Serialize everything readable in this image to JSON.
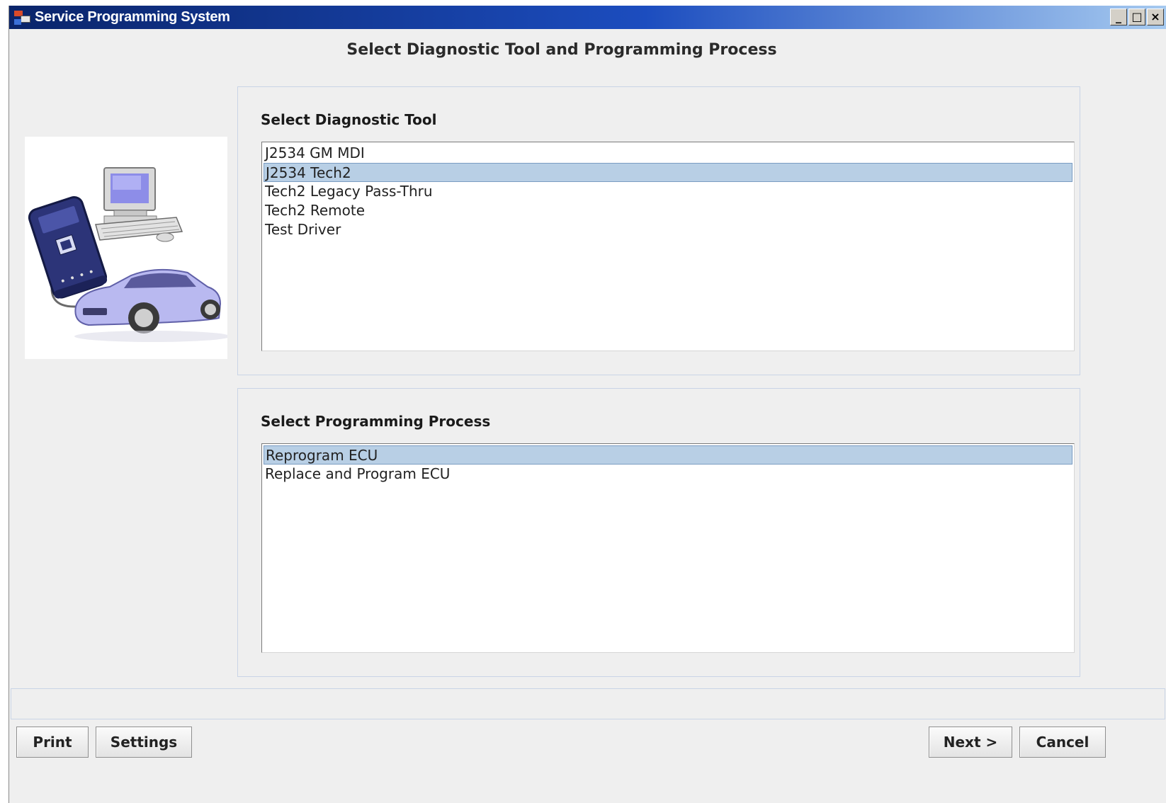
{
  "window": {
    "title": "Service Programming System",
    "controls": [
      "_",
      "□",
      "×"
    ]
  },
  "page": {
    "heading": "Select Diagnostic Tool and Programming Process"
  },
  "diagnostic_tool": {
    "label": "Select Diagnostic Tool",
    "items": [
      {
        "label": "J2534 GM MDI",
        "selected": false
      },
      {
        "label": "J2534 Tech2",
        "selected": true
      },
      {
        "label": "Tech2 Legacy Pass-Thru",
        "selected": false
      },
      {
        "label": "Tech2 Remote",
        "selected": false
      },
      {
        "label": "Test Driver",
        "selected": false
      }
    ]
  },
  "programming_process": {
    "label": "Select Programming Process",
    "items": [
      {
        "label": "Reprogram ECU",
        "selected": true
      },
      {
        "label": "Replace and Program ECU",
        "selected": false
      }
    ]
  },
  "buttons": {
    "print": "Print",
    "settings": "Settings",
    "next": "Next >",
    "cancel": "Cancel"
  },
  "colors": {
    "titlebar_start": "#0a246a",
    "titlebar_end": "#a6caf0",
    "selection": "#b8cfe5",
    "car": "#b9b9f0",
    "device": "#2c3478"
  }
}
